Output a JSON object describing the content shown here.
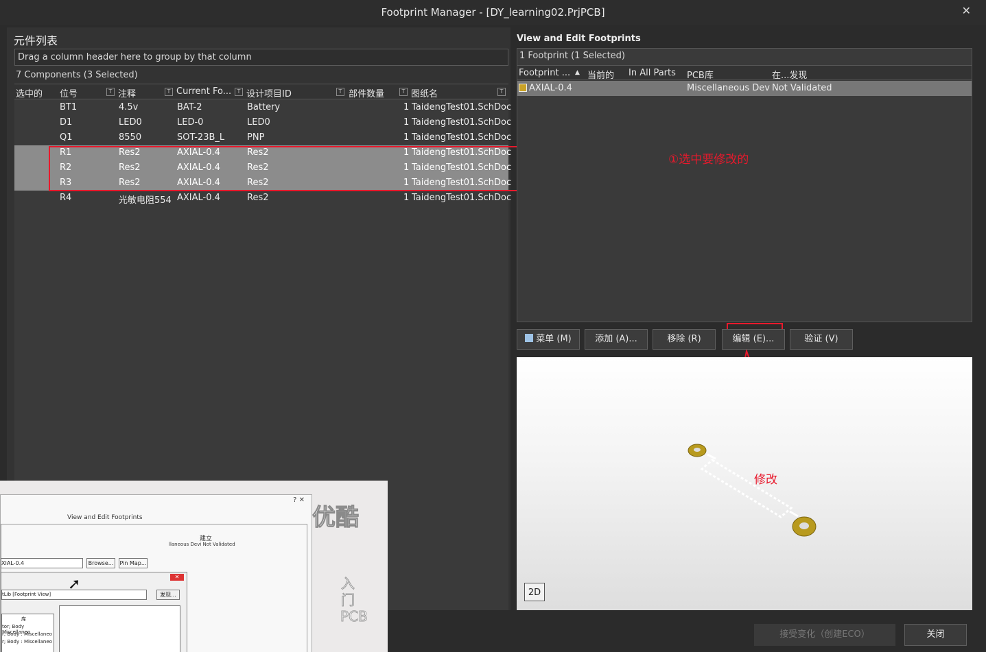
{
  "window": {
    "title": "Footprint Manager - [DY_learning02.PrjPCB]",
    "close_symbol": "✕"
  },
  "left": {
    "heading": "元件列表",
    "group_hint": "Drag a column header here to group by that column",
    "count_text": "7 Components (3 Selected)",
    "columns": [
      "选中的",
      "位号",
      "注释",
      "Current Fo...",
      "设计项目ID",
      "部件数量",
      "图纸名"
    ],
    "rows": [
      {
        "designator": "BT1",
        "comment": "4.5v",
        "footprint": "BAT-2",
        "design_id": "Battery",
        "parts": "1",
        "sheet": "TaidengTest01.SchDoc",
        "selected": false
      },
      {
        "designator": "D1",
        "comment": "LED0",
        "footprint": "LED-0",
        "design_id": "LED0",
        "parts": "1",
        "sheet": "TaidengTest01.SchDoc",
        "selected": false
      },
      {
        "designator": "Q1",
        "comment": "8550",
        "footprint": "SOT-23B_L",
        "design_id": "PNP",
        "parts": "1",
        "sheet": "TaidengTest01.SchDoc",
        "selected": false
      },
      {
        "designator": "R1",
        "comment": "Res2",
        "footprint": "AXIAL-0.4",
        "design_id": "Res2",
        "parts": "1",
        "sheet": "TaidengTest01.SchDoc",
        "selected": true
      },
      {
        "designator": "R2",
        "comment": "Res2",
        "footprint": "AXIAL-0.4",
        "design_id": "Res2",
        "parts": "1",
        "sheet": "TaidengTest01.SchDoc",
        "selected": true
      },
      {
        "designator": "R3",
        "comment": "Res2",
        "footprint": "AXIAL-0.4",
        "design_id": "Res2",
        "parts": "1",
        "sheet": "TaidengTest01.SchDoc",
        "selected": true
      },
      {
        "designator": "R4",
        "comment": "光敏电阻554",
        "footprint": "AXIAL-0.4",
        "design_id": "Res2",
        "parts": "1",
        "sheet": "TaidengTest01.SchDoc",
        "selected": false
      }
    ]
  },
  "right": {
    "heading": "View and Edit Footprints",
    "count_text": "1 Footprint (1 Selected)",
    "columns": [
      "Footprint ...",
      "当前的",
      "In All Parts",
      "PCB库",
      "在...发现"
    ],
    "footprint_row": {
      "name": "AXIAL-0.4",
      "library": "Miscellaneous Devic",
      "found": "Not Validated"
    },
    "buttons": {
      "menu": "菜单 (M)",
      "add": "添加 (A)...",
      "remove": "移除 (R)",
      "edit": "编辑 (E)...",
      "validate": "验证 (V)"
    },
    "view_mode": "2D"
  },
  "footer": {
    "accept": "接受变化（创建ECO）",
    "close": "关闭"
  },
  "annotations": {
    "select_note": "①选中要修改的",
    "edit_note": "修改",
    "color": "#e8192c"
  },
  "overlay": {
    "brand": "优酷",
    "vertical_text": "入门PCB",
    "mini_heading": "View and Edit Footprints",
    "mini_found": "llaneous Devi Not Validated",
    "mini_value": "XIAL-0.4",
    "mini_browse": "Browse...",
    "mini_pinmap": "Pin Map...",
    "mini_lib": "tLib [Footprint View]",
    "mini_find": "发现...",
    "mini_col": "建立",
    "mini_col2": "库",
    "mini_lines": [
      "tor; Body Miscellaneo",
      "r; Body : Miscellaneo",
      "r; Body : Miscellaneo"
    ]
  }
}
